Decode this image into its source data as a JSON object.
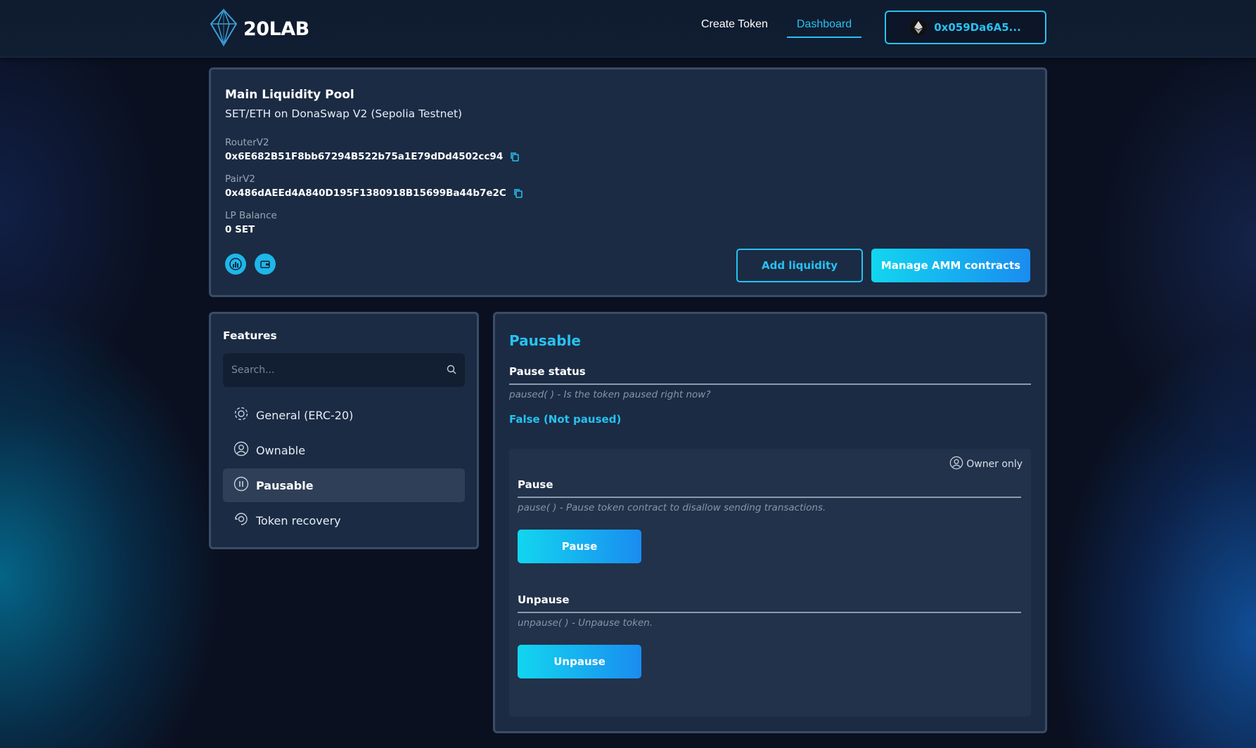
{
  "header": {
    "logo_text": "20LAB",
    "nav": {
      "create_token": "Create Token",
      "dashboard": "Dashboard"
    },
    "wallet": {
      "address": "0x059Da6A5..."
    }
  },
  "pool": {
    "title": "Main Liquidity Pool",
    "subtitle": "SET/ETH on DonaSwap V2 (Sepolia Testnet)",
    "router_label": "RouterV2",
    "router_value": "0x6E682B51F8bb67294B522b75a1E79dDd4502cc94",
    "pair_label": "PairV2",
    "pair_value": "0x486dAEEd4A840D195F1380918B15699Ba44b7e2C",
    "lp_label": "LP Balance",
    "lp_value": "0 SET",
    "add_liquidity": "Add liquidity",
    "manage_amm": "Manage AMM contracts"
  },
  "features": {
    "title": "Features",
    "search_placeholder": "Search...",
    "items": [
      {
        "label": "General (ERC-20)",
        "icon": "gear-icon"
      },
      {
        "label": "Ownable",
        "icon": "user-circle-icon"
      },
      {
        "label": "Pausable",
        "icon": "pause-circle-icon"
      },
      {
        "label": "Token recovery",
        "icon": "recovery-icon"
      }
    ],
    "active_index": 2
  },
  "pausable": {
    "title": "Pausable",
    "status_heading": "Pause status",
    "status_desc": "paused( ) - Is the token paused right now?",
    "status_value": "False (Not paused)",
    "owner_only": "Owner only",
    "pause_heading": "Pause",
    "pause_desc": "pause( ) - Pause token contract to disallow sending transactions.",
    "pause_button": "Pause",
    "unpause_heading": "Unpause",
    "unpause_desc": "unpause( ) - Unpause token.",
    "unpause_button": "Unpause"
  },
  "colors": {
    "accent": "#27c2f0",
    "card_bg": "#1b2b44",
    "page_bg": "#0a1020"
  }
}
